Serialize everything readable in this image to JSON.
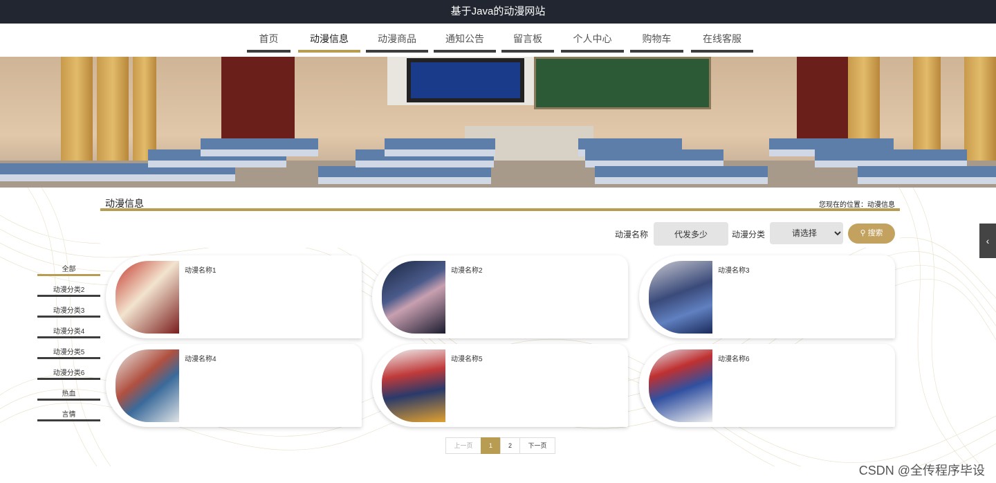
{
  "site": {
    "title": "基于Java的动漫网站"
  },
  "nav": {
    "items": [
      {
        "label": "首页"
      },
      {
        "label": "动漫信息",
        "active": true
      },
      {
        "label": "动漫商品"
      },
      {
        "label": "通知公告"
      },
      {
        "label": "留言板"
      },
      {
        "label": "个人中心"
      },
      {
        "label": "购物车"
      },
      {
        "label": "在线客服"
      }
    ]
  },
  "section": {
    "title": "动漫信息",
    "breadcrumb": "您现在的位置：动漫信息"
  },
  "search": {
    "name_label": "动漫名称",
    "name_value": "代发多少",
    "category_label": "动漫分类",
    "category_selected": "请选择",
    "button_label": "搜索"
  },
  "categories": [
    {
      "label": "全部",
      "active": true
    },
    {
      "label": "动漫分类2"
    },
    {
      "label": "动漫分类3"
    },
    {
      "label": "动漫分类4"
    },
    {
      "label": "动漫分类5"
    },
    {
      "label": "动漫分类6"
    },
    {
      "label": "热血"
    },
    {
      "label": "言情"
    }
  ],
  "cards": [
    {
      "name": "动漫名称1"
    },
    {
      "name": "动漫名称2"
    },
    {
      "name": "动漫名称3"
    },
    {
      "name": "动漫名称4"
    },
    {
      "name": "动漫名称5"
    },
    {
      "name": "动漫名称6"
    }
  ],
  "pagination": {
    "prev": "上一页",
    "pages": [
      "1",
      "2"
    ],
    "current": "1",
    "next": "下一页"
  },
  "side_tab": {
    "icon": "chevron-left-icon",
    "glyph": "‹"
  },
  "watermark": "CSDN @全传程序毕设",
  "colors": {
    "accent": "#b89c52",
    "header_bg": "#212630",
    "button": "#c3a15e"
  }
}
